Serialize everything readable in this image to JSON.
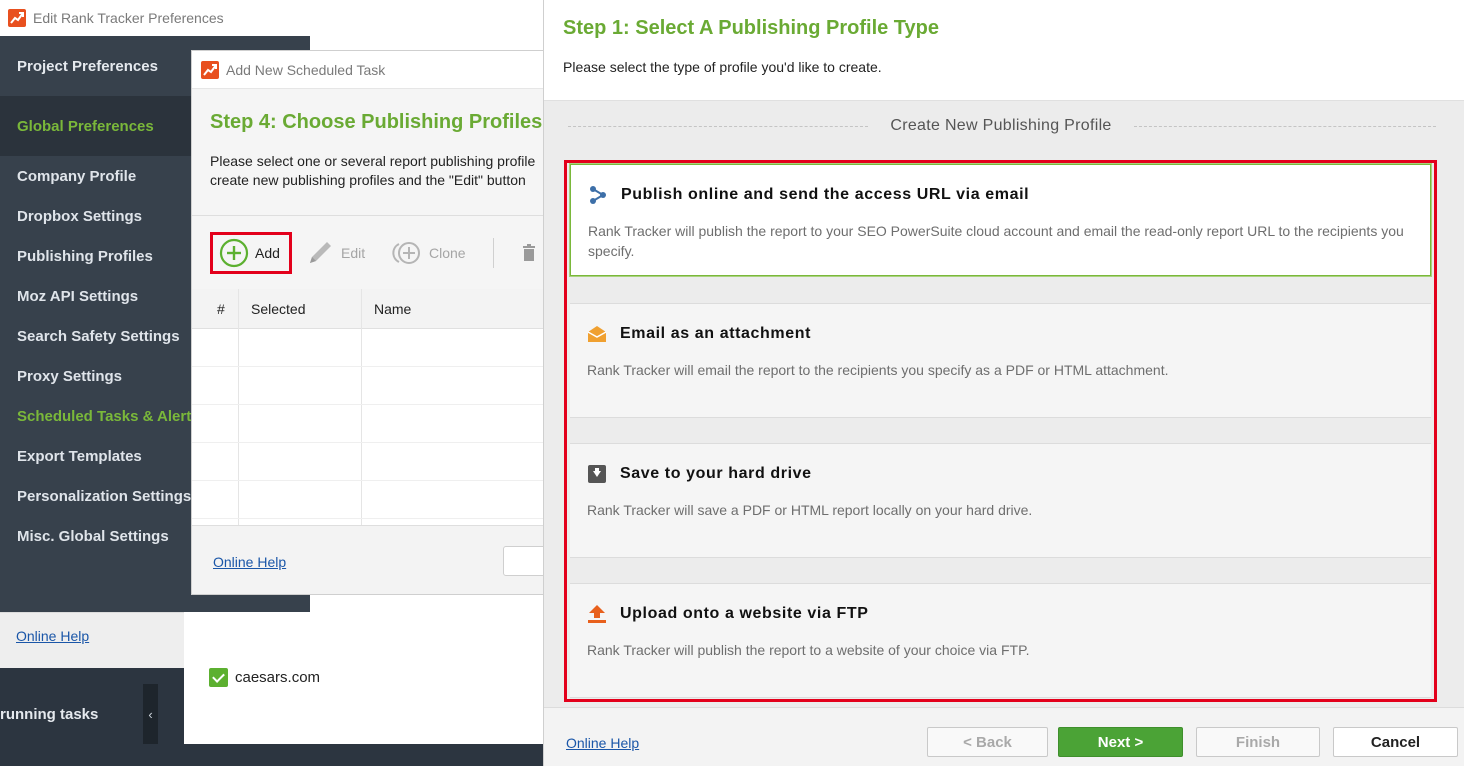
{
  "prefs_window": {
    "title": "Edit Rank Tracker Preferences",
    "project_preferences": "Project Preferences",
    "global_preferences": "Global Preferences",
    "sidebar_items": [
      "Company Profile",
      "Dropbox Settings",
      "Publishing Profiles",
      "Moz API Settings",
      "Search Safety Settings",
      "Proxy Settings",
      "Scheduled Tasks & Alerts",
      "Export Templates",
      "Personalization Settings",
      "Misc. Global Settings"
    ],
    "active_item": "Scheduled Tasks & Alerts",
    "online_help": "Online Help"
  },
  "app_background": {
    "running_tasks": "running tasks",
    "collapse_glyph": "‹",
    "row_domain": "caesars.com"
  },
  "task_dialog": {
    "title": "Add New Scheduled Task",
    "step_title": "Step 4: Choose Publishing Profiles",
    "description_line1": "Please select one or several report publishing profile",
    "description_line2": "create new publishing profiles and the \"Edit\" button",
    "toolbar": {
      "add": "Add",
      "edit": "Edit",
      "clone": "Clone"
    },
    "table_headers": [
      "#",
      "Selected",
      "Name"
    ],
    "online_help": "Online Help"
  },
  "profile_dialog": {
    "step_title": "Step 1: Select A Publishing Profile Type",
    "description": "Please select the type of profile you'd like to create.",
    "section_label": "Create New Publishing Profile",
    "options": [
      {
        "icon": "share-icon",
        "title": "Publish online and send the access URL via email",
        "description": "Rank Tracker will publish the report to your SEO PowerSuite cloud account and email the read-only report URL to the recipients you specify."
      },
      {
        "icon": "envelope-icon",
        "title": "Email as an attachment",
        "description": "Rank Tracker will email the report to the recipients you specify as a PDF or HTML attachment."
      },
      {
        "icon": "hard-drive-icon",
        "title": "Save to your hard drive",
        "description": "Rank Tracker will save a PDF or HTML report locally on your hard drive."
      },
      {
        "icon": "upload-icon",
        "title": "Upload onto a website via FTP",
        "description": "Rank Tracker will publish the report to a website of your choice via FTP."
      }
    ],
    "selected_option": "Publish online and send the access URL via email",
    "footer": {
      "online_help": "Online Help",
      "back": "< Back",
      "next": "Next >",
      "finish": "Finish",
      "cancel": "Cancel"
    }
  },
  "colors": {
    "accent_green": "#6aaa34",
    "sidebar_bg": "#37414c",
    "highlight_red": "#e3001b",
    "next_button": "#4ba336",
    "link_blue": "#1a56a8"
  }
}
